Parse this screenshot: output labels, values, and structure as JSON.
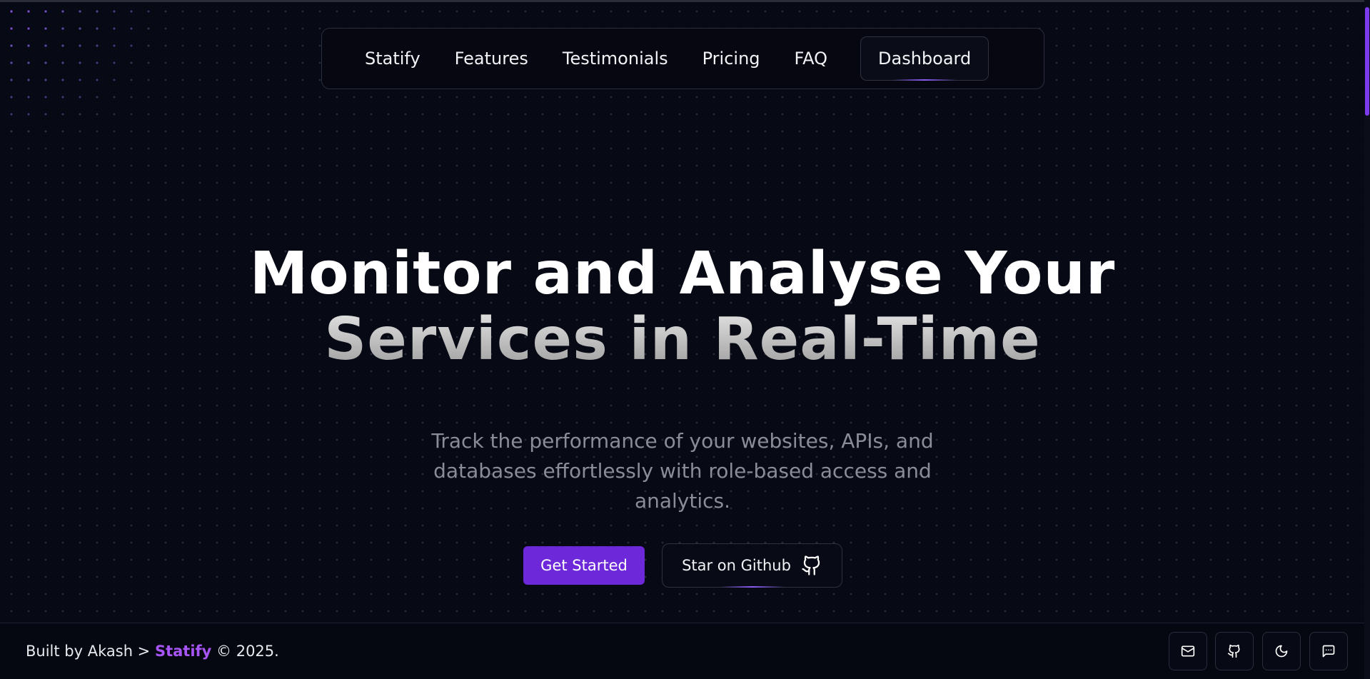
{
  "nav": {
    "items": [
      {
        "label": "Statify"
      },
      {
        "label": "Features"
      },
      {
        "label": "Testimonials"
      },
      {
        "label": "Pricing"
      },
      {
        "label": "FAQ"
      }
    ],
    "dashboard_label": "Dashboard"
  },
  "hero": {
    "title_line1": "Monitor and Analyse Your",
    "title_line2": "Services in Real-Time",
    "subtitle": "Track the performance of your websites, APIs, and databases effortlessly with role-based access and analytics.",
    "cta_primary": "Get Started",
    "cta_secondary": "Star on Github",
    "cta_secondary_icon": "github-icon"
  },
  "footer": {
    "text_prefix": "Built by Akash > ",
    "brand": "Statify",
    "text_suffix": " © 2025.",
    "icons": [
      "mail-icon",
      "github-icon",
      "moon-icon",
      "message-icon"
    ]
  },
  "colors": {
    "background": "#070a14",
    "accent": "#6d28d9",
    "brand": "#a855f7",
    "scroll_thumb": "#7c3aed"
  }
}
